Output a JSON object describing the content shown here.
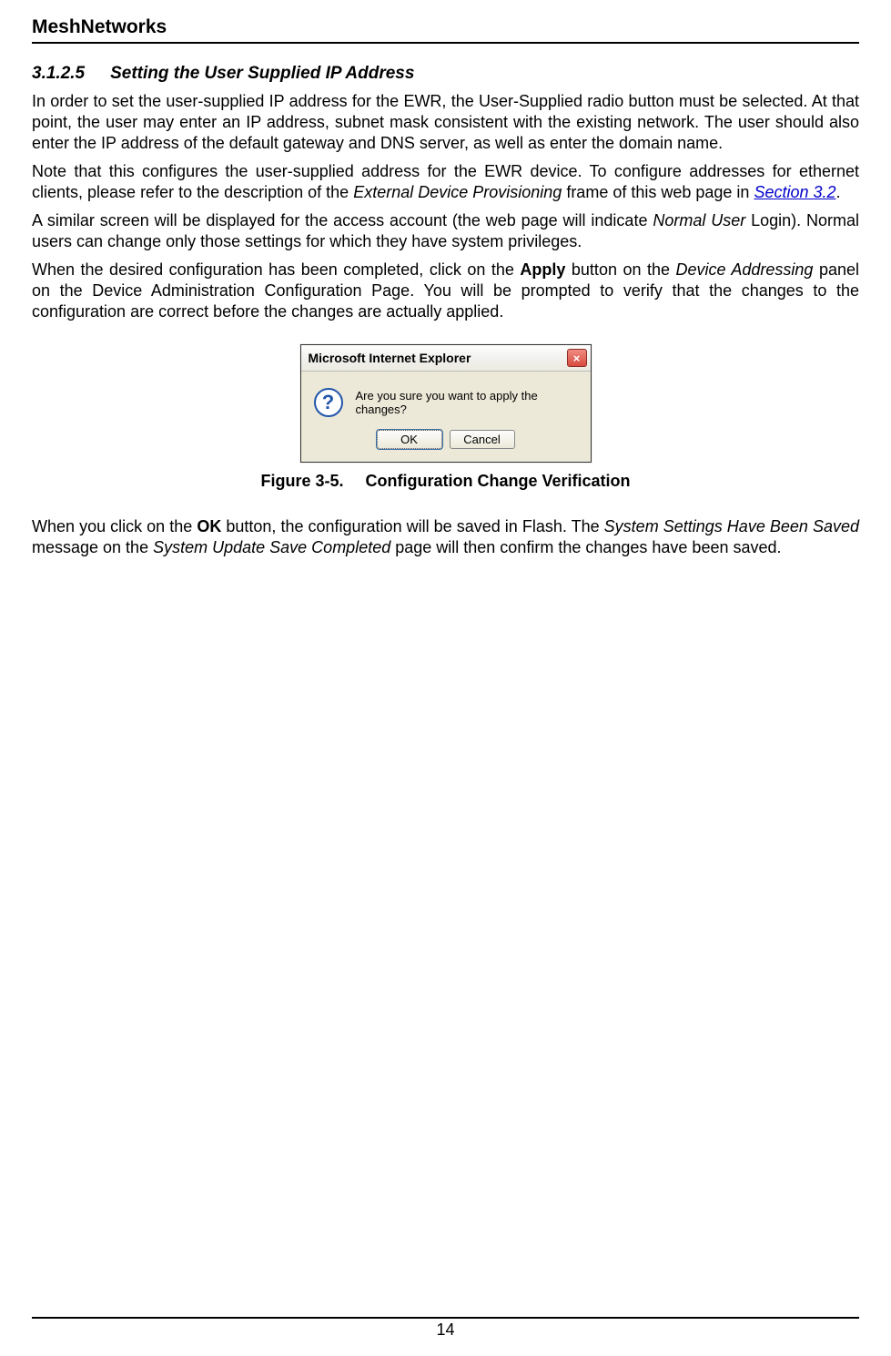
{
  "header": {
    "title": "MeshNetworks"
  },
  "section": {
    "number": "3.1.2.5",
    "title": "Setting the User Supplied IP Address"
  },
  "paragraphs": {
    "p1": "In order to set the user-supplied IP address for the EWR, the User-Supplied radio button must be selected. At that point, the user may enter an IP address, subnet mask consistent with the existing network. The user should also enter the IP address of the default gateway and DNS server, as well as enter the domain name.",
    "p2_pre": "Note that this configures the user-supplied address for the EWR device. To configure addresses for ethernet clients, please refer to the description of the ",
    "p2_italic": "External Device Provisioning",
    "p2_mid": " frame of this web page in ",
    "p2_link": "Section 3.2",
    "p2_post": ".",
    "p3_pre": "A similar screen will be displayed for the access account (the web page will indicate ",
    "p3_italic": "Normal User",
    "p3_post": " Login).  Normal users can change only those settings for which they have system privileges.",
    "p4_pre": "When the desired configuration has been completed, click on the ",
    "p4_bold": "Apply",
    "p4_mid": " button on the ",
    "p4_italic": "Device Addressing",
    "p4_post": " panel on the Device Administration Configuration Page.  You will be prompted to verify that the changes to the configuration are correct before the changes are actually applied.",
    "p5_pre": "When you click on the ",
    "p5_bold": "OK",
    "p5_mid": " button, the configuration will be saved in Flash.  The ",
    "p5_italic1": "System Settings Have Been Saved",
    "p5_mid2": " message on the ",
    "p5_italic2": "System Update Save Completed",
    "p5_post": " page will then confirm the changes have been saved."
  },
  "dialog": {
    "title": "Microsoft Internet Explorer",
    "close": "×",
    "icon": "?",
    "message": "Are you sure you want to apply the changes?",
    "ok": "OK",
    "cancel": "Cancel"
  },
  "figure": {
    "number": "Figure 3-5.",
    "caption": "Configuration Change Verification"
  },
  "footer": {
    "page": "14"
  }
}
